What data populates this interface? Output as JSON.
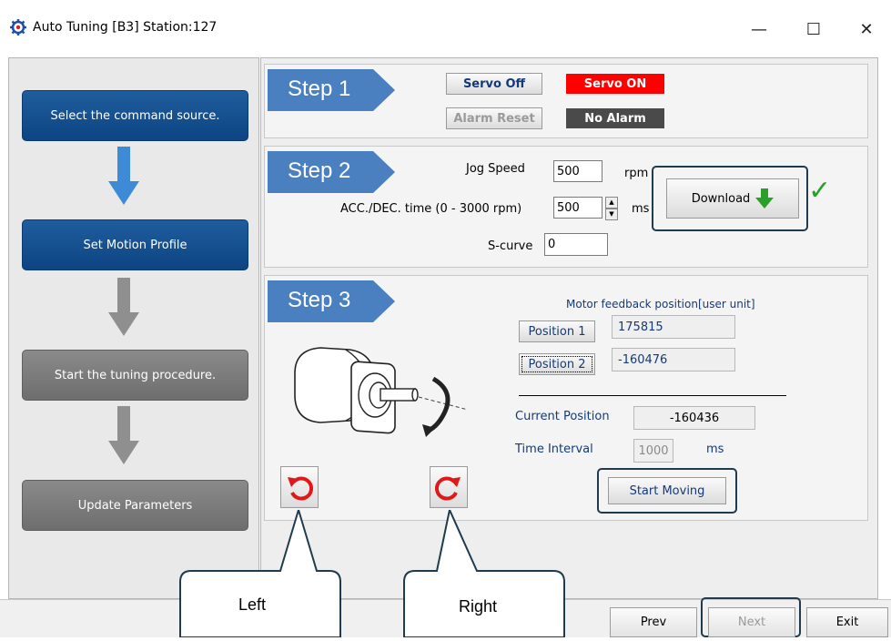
{
  "window": {
    "title": "Auto Tuning [B3] Station:127",
    "minimize_glyph": "—",
    "maximize_glyph": "☐",
    "close_glyph": "✕"
  },
  "sidebar": {
    "steps": [
      {
        "label": "Select the command source.",
        "state": "active"
      },
      {
        "label": "Set Motion Profile",
        "state": "active"
      },
      {
        "label": "Start the tuning procedure.",
        "state": "inactive"
      },
      {
        "label": "Update Parameters",
        "state": "inactive"
      }
    ]
  },
  "step1": {
    "label": "Step 1",
    "servo_off": "Servo Off",
    "servo_on": "Servo ON",
    "alarm_reset": "Alarm Reset",
    "alarm_status": "No Alarm"
  },
  "step2": {
    "label": "Step 2",
    "jog_speed_label": "Jog Speed",
    "jog_speed_value": "500",
    "jog_speed_unit": "rpm",
    "acc_label": "ACC./DEC. time (0 - 3000 rpm)",
    "acc_value": "500",
    "acc_unit": "ms",
    "scurve_label": "S-curve",
    "scurve_value": "0",
    "download": "Download",
    "download_status": "✓"
  },
  "step3": {
    "label": "Step 3",
    "feedback_title": "Motor feedback position[user unit]",
    "position1_label": "Position 1",
    "position1_value": "175815",
    "position2_label": "Position 2",
    "position2_value": "-160476",
    "current_position_label": "Current Position",
    "current_position_value": "-160436",
    "time_interval_label": "Time Interval",
    "time_interval_value": "1000",
    "time_interval_unit": "ms",
    "start_moving": "Start Moving"
  },
  "nav": {
    "prev": "Prev",
    "next": "Next",
    "exit": "Exit"
  },
  "callouts": {
    "left": "Left",
    "right": "Right"
  },
  "colors": {
    "step_blue": "#1f5d9e",
    "step_gray": "#7a7a7a",
    "servo_on_bg": "#ff0000",
    "no_alarm_bg": "#4a4a4a",
    "banner": "#4a7fc0",
    "highlight": "#1f3b4d",
    "check": "#2aa02a"
  }
}
